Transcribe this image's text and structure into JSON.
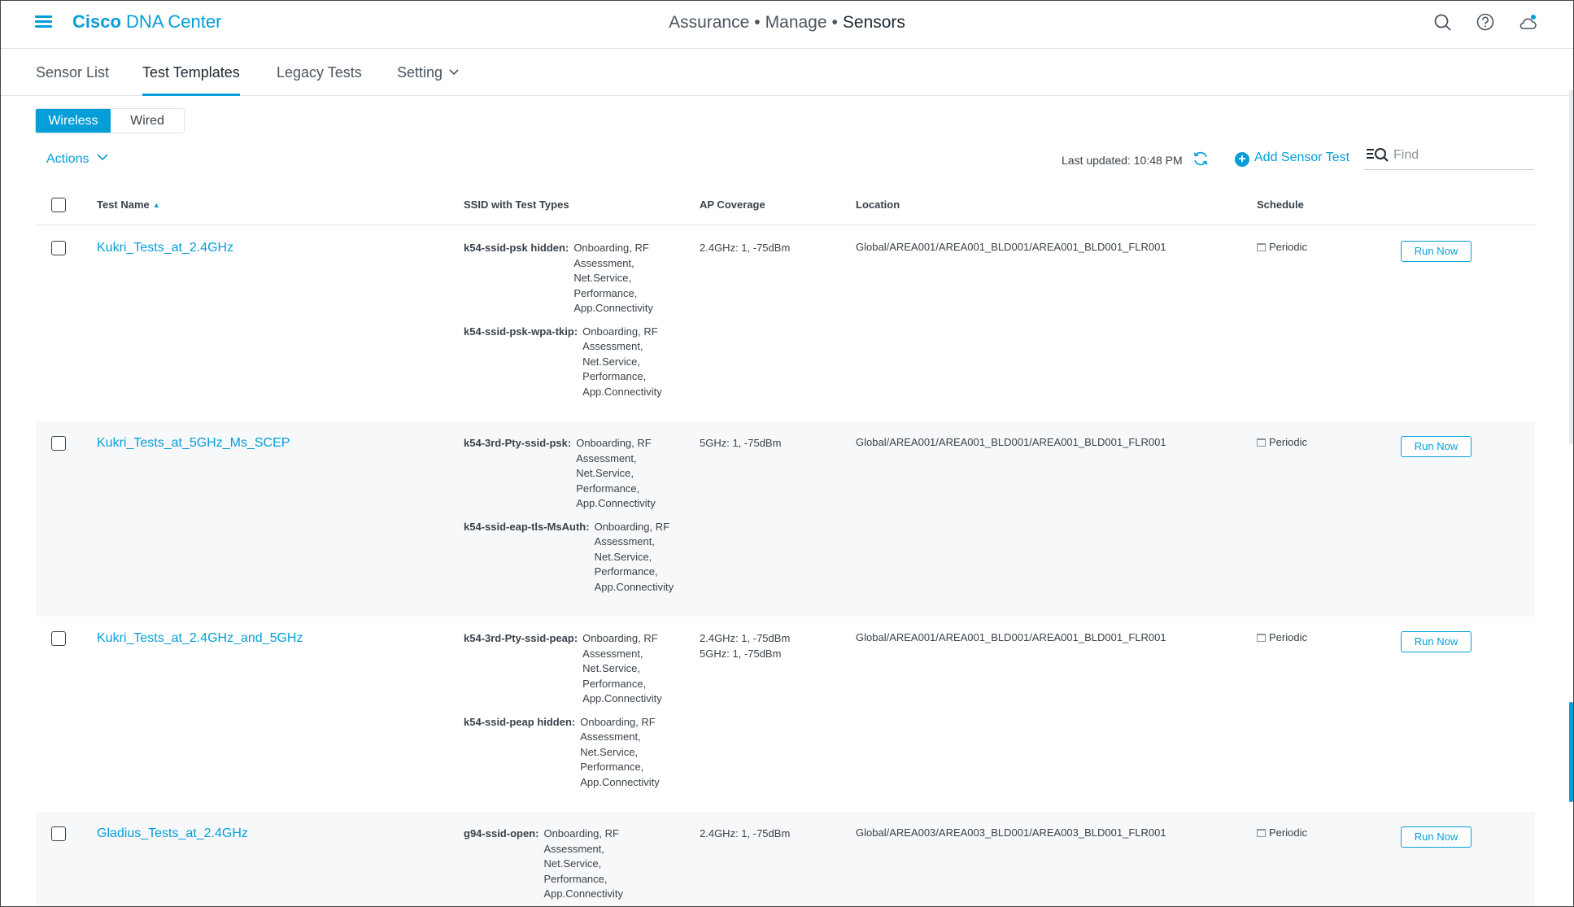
{
  "header": {
    "brand_bold": "Cisco",
    "brand_rest": "DNA Center",
    "crumbs": [
      "Assurance",
      "Manage",
      "Sensors"
    ],
    "separator": "•"
  },
  "tabs": [
    {
      "label": "Sensor List",
      "active": false
    },
    {
      "label": "Test Templates",
      "active": true
    },
    {
      "label": "Legacy Tests",
      "active": false
    },
    {
      "label": "Setting",
      "active": false,
      "dropdown": true
    }
  ],
  "toggle": {
    "wireless": "Wireless",
    "wired": "Wired",
    "selected": "Wireless"
  },
  "toolbar": {
    "actions_label": "Actions",
    "last_updated": "Last updated: 10:48 PM",
    "add_label": "Add Sensor Test",
    "find_placeholder": "Find"
  },
  "table": {
    "columns": [
      "Test Name",
      "SSID with Test Types",
      "AP Coverage",
      "Location",
      "Schedule"
    ],
    "rows": [
      {
        "name": "Kukri_Tests_at_2.4GHz",
        "ssids": [
          {
            "ssid": "k54-ssid-psk hidden:",
            "types": "Onboarding, RF Assessment, Net.Service, Performance, App.Connectivity"
          },
          {
            "ssid": "k54-ssid-psk-wpa-tkip:",
            "types": "Onboarding, RF Assessment, Net.Service, Performance, App.Connectivity"
          }
        ],
        "ap": [
          "2.4GHz: 1, -75dBm"
        ],
        "location": "Global/AREA001/AREA001_BLD001/AREA001_BLD001_FLR001",
        "schedule": "Periodic",
        "action": "Run Now"
      },
      {
        "name": "Kukri_Tests_at_5GHz_Ms_SCEP",
        "ssids": [
          {
            "ssid": "k54-3rd-Pty-ssid-psk:",
            "types": "Onboarding, RF Assessment, Net.Service, Performance, App.Connectivity"
          },
          {
            "ssid": "k54-ssid-eap-tls-MsAuth:",
            "types": "Onboarding, RF Assessment, Net.Service, Performance, App.Connectivity"
          }
        ],
        "ap": [
          "5GHz: 1, -75dBm"
        ],
        "location": "Global/AREA001/AREA001_BLD001/AREA001_BLD001_FLR001",
        "schedule": "Periodic",
        "action": "Run Now"
      },
      {
        "name": "Kukri_Tests_at_2.4GHz_and_5GHz",
        "ssids": [
          {
            "ssid": "k54-3rd-Pty-ssid-peap:",
            "types": "Onboarding, RF Assessment, Net.Service, Performance, App.Connectivity"
          },
          {
            "ssid": "k54-ssid-peap hidden:",
            "types": "Onboarding, RF Assessment, Net.Service, Performance, App.Connectivity"
          }
        ],
        "ap": [
          "2.4GHz: 1, -75dBm",
          "5GHz: 1, -75dBm"
        ],
        "location": "Global/AREA001/AREA001_BLD001/AREA001_BLD001_FLR001",
        "schedule": "Periodic",
        "action": "Run Now"
      },
      {
        "name": "Gladius_Tests_at_2.4GHz",
        "ssids": [
          {
            "ssid": "g94-ssid-open:",
            "types": "Onboarding, RF Assessment, Net.Service, Performance, App.Connectivity"
          }
        ],
        "ap": [
          "2.4GHz: 1, -75dBm"
        ],
        "location": "Global/AREA003/AREA003_BLD001/AREA003_BLD001_FLR001",
        "schedule": "Periodic",
        "action": "Run Now"
      }
    ]
  }
}
